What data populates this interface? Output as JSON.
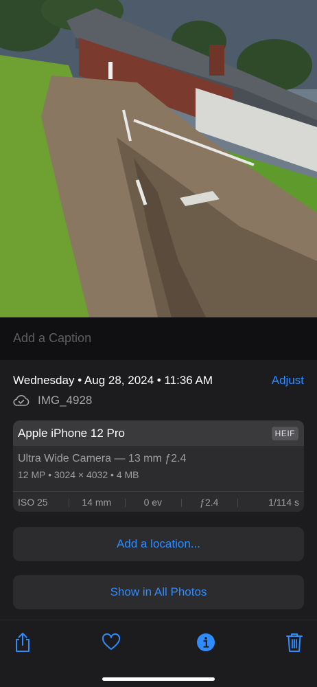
{
  "caption": {
    "placeholder": "Add a Caption"
  },
  "meta": {
    "date": "Wednesday • Aug 28, 2024 • 11:36 AM",
    "adjust_label": "Adjust",
    "filename": "IMG_4928",
    "cloud_icon": "icloud-check-icon"
  },
  "camera": {
    "device": "Apple iPhone 12 Pro",
    "format": "HEIF",
    "lens": "Ultra Wide Camera — 13 mm ƒ2.4",
    "specs": "12 MP  •  3024 × 4032  •  4 MB",
    "exif": {
      "iso": "ISO 25",
      "focal": "14 mm",
      "ev": "0 ev",
      "aperture": "ƒ2.4",
      "shutter": "1/114 s"
    }
  },
  "actions": {
    "add_location": "Add a location...",
    "show_all": "Show in All Photos"
  },
  "toolbar": {
    "icons": [
      "share-icon",
      "heart-icon",
      "info-icon",
      "trash-icon"
    ]
  },
  "colors": {
    "accent": "#2f8cff",
    "background": "#1c1c1e",
    "card": "#2c2c2e"
  }
}
